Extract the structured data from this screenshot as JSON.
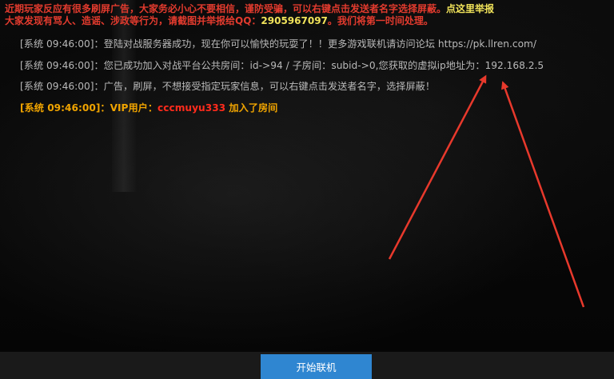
{
  "notice": {
    "line1_prefix": "近期玩家反应有很多刷屏广告，大家务必小心不要相信，谨防受骗，可以右键点击发送者名字选择屏蔽。",
    "report_link": "点这里举报",
    "line2_prefix": "大家发现有骂人、造谣、涉政等行为，请截图并举报给QQ：",
    "qq": "2905967097",
    "line2_suffix": "。我们将第一时间处理。"
  },
  "messages": [
    {
      "tag": "[系统 09:46:00]",
      "text": "：登陆对战服务器成功，现在你可以愉快的玩耍了！！更多游戏联机请访问论坛 https://pk.llren.com/"
    },
    {
      "tag": "[系统 09:46:00]",
      "text": "：您已成功加入对战平台公共房间：id->94 / 子房间：subid->0,您获取的虚拟ip地址为：192.168.2.5"
    },
    {
      "tag": "[系统 09:46:00]",
      "text": "：广告，刷屏，不想接受指定玩家信息，可以右键点击发送者名字，选择屏蔽！"
    }
  ],
  "vip_message": {
    "tag": "[系统 09:46:00]",
    "prefix": "：VIP用户：",
    "username": "cccmuyu333",
    "suffix": " 加入了房间"
  },
  "connect_button": "开始联机",
  "colors": {
    "notice_red": "#e33b2e",
    "highlight_yellow": "#f1e35a",
    "system_gray": "#b9b9b9",
    "vip_orange": "#f0a400",
    "vip_user_red": "#ff2b1c",
    "button_blue": "#2f86d1",
    "arrow_red": "#e8392c"
  }
}
